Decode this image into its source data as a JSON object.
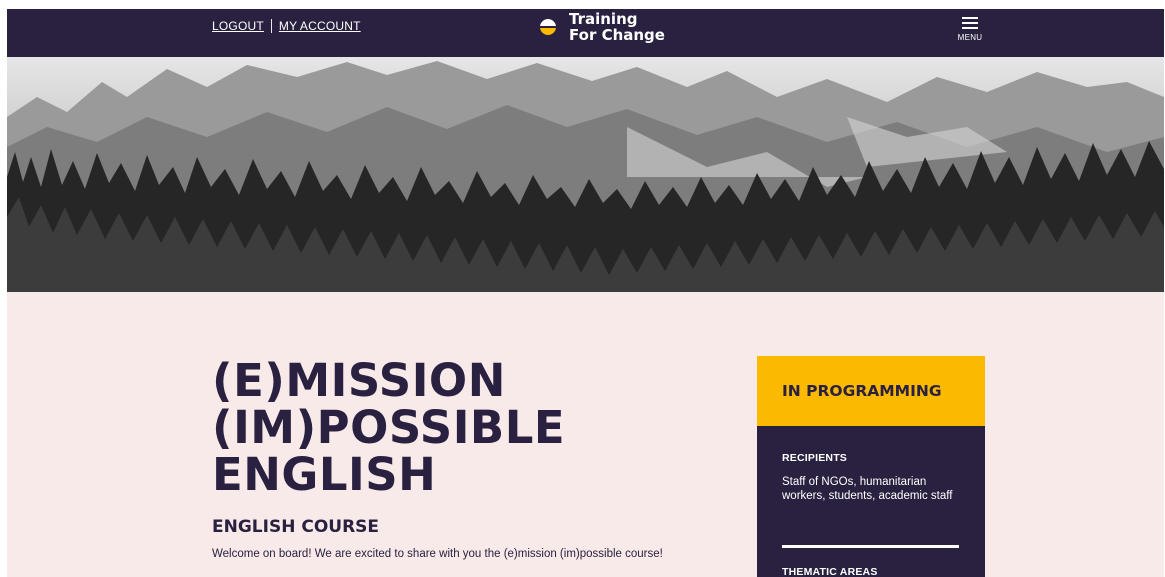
{
  "header": {
    "logout_label": "LOGOUT",
    "account_label": "MY ACCOUNT",
    "brand_line1": "Training",
    "brand_line2": "For Change",
    "menu_label": "MENU"
  },
  "hero": {
    "image": "black-and-white photo of a pine forest below rocky mountains"
  },
  "main": {
    "title_lines": [
      "(E)MISSION",
      "(IM)POSSIBLE",
      "ENGLISH"
    ],
    "subtitle": "ENGLISH COURSE",
    "intro": "Welcome on board! We are excited to share with you the (e)mission (im)possible course!"
  },
  "card": {
    "heading": "IN PROGRAMMING",
    "recipients_label": "RECIPIENTS",
    "recipients_value": "Staff of NGOs, humanitarian workers, students, academic staff",
    "thematic_label": "THEMATIC AREAS"
  },
  "colors": {
    "navy": "#2a2140",
    "yellow": "#fbb900",
    "blush": "#f8eae8"
  }
}
